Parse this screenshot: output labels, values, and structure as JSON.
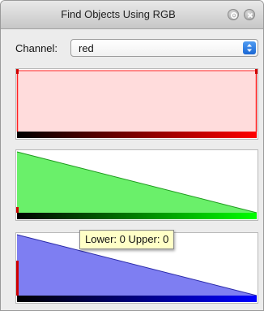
{
  "window": {
    "title": "Find Objects Using RGB",
    "buttons": [
      {
        "name": "settings",
        "icon": "gear-icon"
      },
      {
        "name": "close",
        "icon": "close-icon"
      }
    ]
  },
  "channel": {
    "label": "Channel:",
    "selected": "red"
  },
  "histograms": [
    {
      "channel": "red",
      "fill_color": "#ffdcdc",
      "range_color": "#ff0000",
      "shape": "flat"
    },
    {
      "channel": "green",
      "fill_color": "#6af06a",
      "range_color": "#00ff00",
      "shape": "decreasing"
    },
    {
      "channel": "blue",
      "fill_color": "#7e7ef2",
      "range_color": "#0000ff",
      "shape": "decreasing"
    }
  ],
  "tooltip": {
    "text": "Lower: 0 Upper: 0"
  }
}
